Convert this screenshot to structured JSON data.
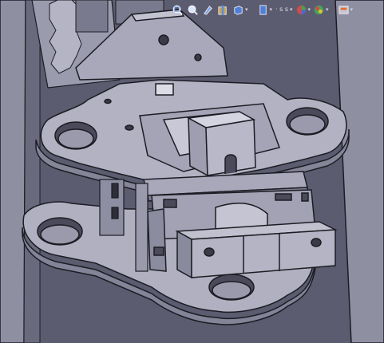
{
  "app": {
    "name": "CAD 3D model viewport"
  },
  "toolbar": {
    "items": [
      {
        "icon": "zoom-to-fit-icon"
      },
      {
        "icon": "zoom-area-icon"
      },
      {
        "icon": "previous-view-icon"
      },
      {
        "icon": "section-view-icon"
      },
      {
        "icon": "view-orientation-icon"
      },
      {
        "icon": "display-style-icon"
      },
      {
        "icon": "hide-show-items-icon",
        "label": "· s s"
      },
      {
        "icon": "edit-appearance-icon"
      },
      {
        "icon": "apply-scene-icon"
      },
      {
        "icon": "view-settings-icon"
      }
    ]
  },
  "colors": {
    "background": "#5f5f72",
    "part_face": "#a6a6b8",
    "part_light": "#bdbdcc",
    "part_shadow": "#7d7d92",
    "edge": "#1c1c24"
  }
}
